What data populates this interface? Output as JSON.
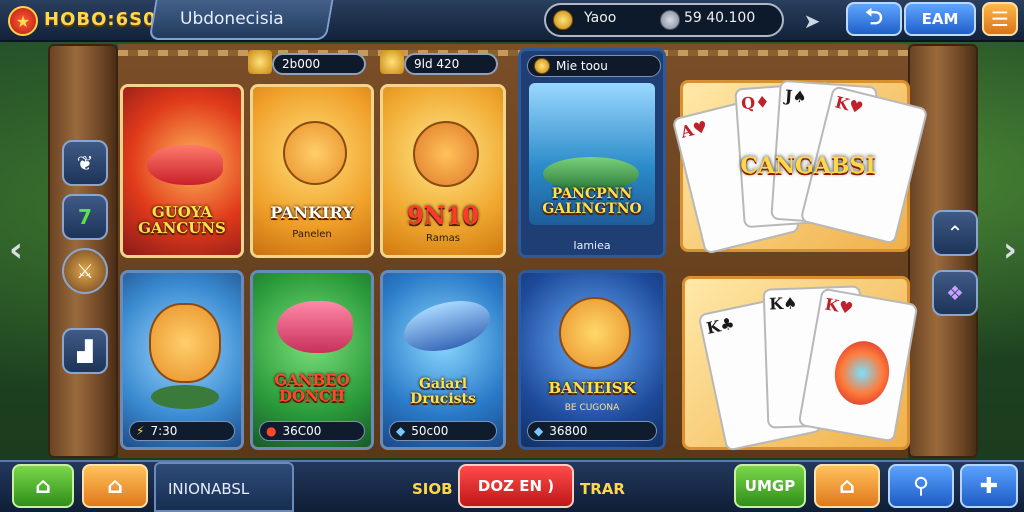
{
  "app": {
    "logo_text": "HOBO:6S0"
  },
  "header": {
    "region": "Ubdonecisia",
    "balances": [
      {
        "label": "Yaoo",
        "icon": "gold-coin-icon"
      },
      {
        "label": "59 40.100",
        "icon": "silver-coin-icon"
      }
    ],
    "earn_label": "EAM"
  },
  "stats": {
    "left": "2b000",
    "right": "9ld 420"
  },
  "games": [
    {
      "title": "GUOYA\nGANCUNS",
      "foot": ""
    },
    {
      "title": "PANKIRY",
      "sub": "Panelen",
      "foot": ""
    },
    {
      "title": "9N10",
      "sub": "Ramas",
      "foot": ""
    },
    {
      "title": "PANCPNN\nGALINGTNO",
      "sub": "Iamiea",
      "badge": "Mie toou",
      "foot": ""
    },
    {
      "title": "",
      "foot": "7:30"
    },
    {
      "title": "GANBEO\nDONCH",
      "foot": "36C00"
    },
    {
      "title": "Gaiarl\nDrucists",
      "foot": "50c00"
    },
    {
      "title": "BANIEISK",
      "sub": "BE CUGONA",
      "foot": "36800"
    }
  ],
  "cards_panels": [
    {
      "title": "CANGABSI"
    },
    {
      "title": ""
    }
  ],
  "bottom": {
    "location": "INIONABSL",
    "left_text": "SIOB",
    "center_button": "DOZ EN )",
    "right_text": "TRAR",
    "shop_button": "UMGP"
  },
  "colors": {
    "accent_gold": "#ffd84a",
    "panel_blue": "#1e3458",
    "cta_red": "#d81e1e"
  }
}
